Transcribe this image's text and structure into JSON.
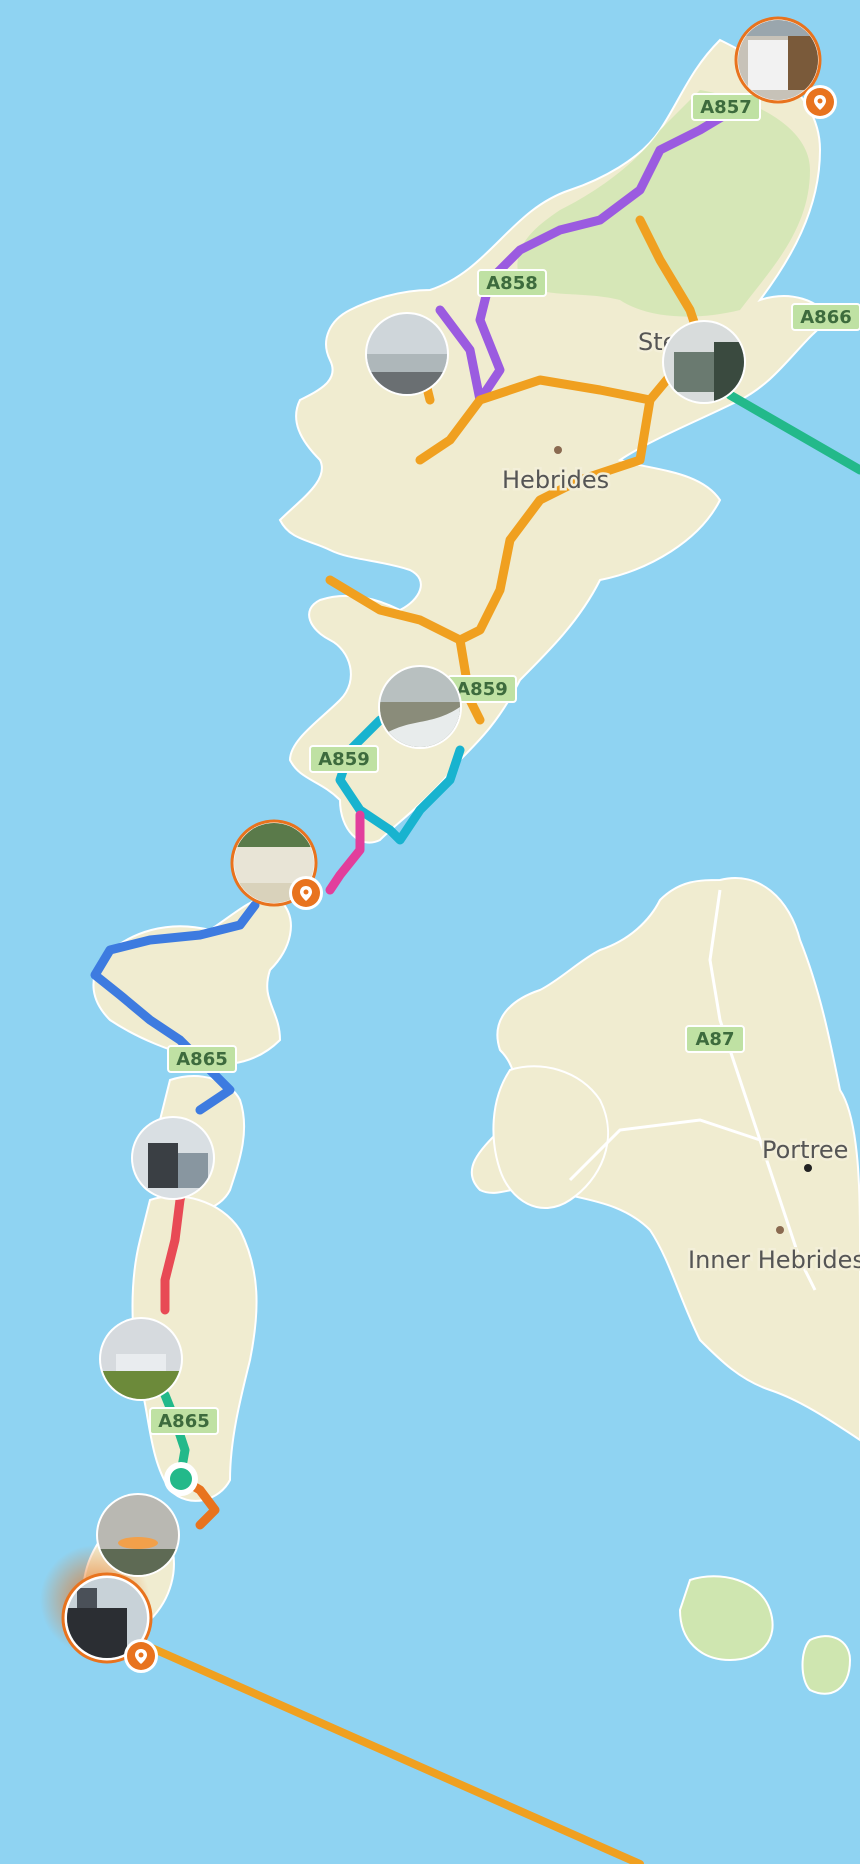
{
  "map": {
    "colors": {
      "sea": "#8fd3f2",
      "land": "#f0ecd0",
      "land_green": "#cfe6b0",
      "shield_bg": "#bfe1a3",
      "shield_border": "#ffffff"
    },
    "places": [
      {
        "id": "stornoway",
        "label": "Stornoway",
        "shown_text": "Ste      way"
      },
      {
        "id": "hebrides",
        "label": "Hebrides"
      },
      {
        "id": "portree",
        "label": "Portree"
      },
      {
        "id": "inner",
        "label": "Inner Hebrides"
      }
    ],
    "roads": [
      {
        "id": "r1",
        "label": "A857"
      },
      {
        "id": "r2",
        "label": "A858"
      },
      {
        "id": "r3",
        "label": "A866"
      },
      {
        "id": "r4",
        "label": "A859"
      },
      {
        "id": "r5",
        "label": "A859"
      },
      {
        "id": "r6",
        "label": "A865"
      },
      {
        "id": "r7",
        "label": "A87"
      },
      {
        "id": "r8",
        "label": "A865"
      }
    ],
    "route_colors": {
      "purple": "#9b5be0",
      "orange": "#f0a020",
      "green": "#23b98a",
      "cyan": "#18b3cf",
      "pink": "#e23e9c",
      "blue": "#3d7be0",
      "red": "#e84a55",
      "dark_orange": "#e8731e"
    },
    "photo_markers": [
      {
        "id": "p1",
        "has_pin": true
      },
      {
        "id": "p2",
        "has_pin": false
      },
      {
        "id": "p3",
        "has_pin": false
      },
      {
        "id": "p4",
        "has_pin": false
      },
      {
        "id": "p5",
        "has_pin": true
      },
      {
        "id": "p6",
        "has_pin": false
      },
      {
        "id": "p7",
        "has_pin": false
      },
      {
        "id": "p8",
        "has_pin": false
      },
      {
        "id": "p9",
        "has_pin": true
      }
    ],
    "icons": [
      "location-pin-icon",
      "start-dot-icon"
    ]
  }
}
